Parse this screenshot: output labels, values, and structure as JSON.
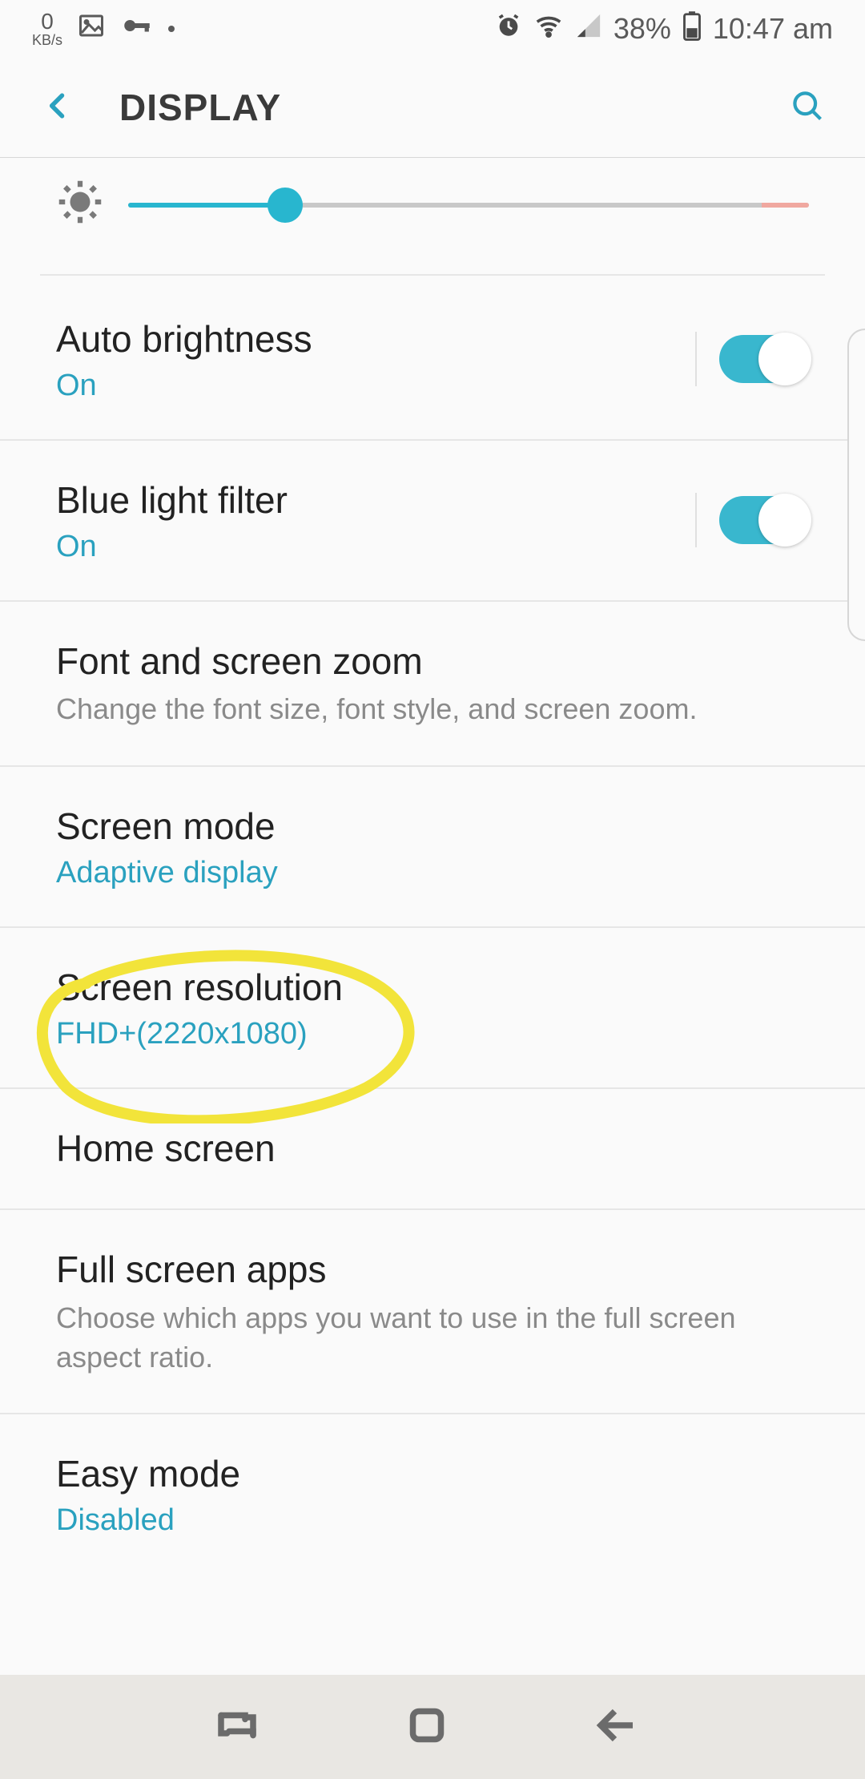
{
  "status": {
    "kbs_value": "0",
    "kbs_unit": "KB/s",
    "battery_pct": "38%",
    "time": "10:47 am"
  },
  "header": {
    "title": "DISPLAY"
  },
  "brightness": {
    "value_pct": 23
  },
  "settings": {
    "auto_brightness": {
      "title": "Auto brightness",
      "status": "On"
    },
    "blue_light": {
      "title": "Blue light filter",
      "status": "On"
    },
    "font_zoom": {
      "title": "Font and screen zoom",
      "desc": "Change the font size, font style, and screen zoom."
    },
    "screen_mode": {
      "title": "Screen mode",
      "status": "Adaptive display"
    },
    "screen_res": {
      "title": "Screen resolution",
      "status": "FHD+(2220x1080)"
    },
    "home_screen": {
      "title": "Home screen"
    },
    "full_screen": {
      "title": "Full screen apps",
      "desc": "Choose which apps you want to use in the full screen aspect ratio."
    },
    "easy_mode": {
      "title": "Easy mode",
      "status": "Disabled"
    }
  },
  "colors": {
    "accent": "#28b6cf",
    "link": "#2aa1bf"
  }
}
